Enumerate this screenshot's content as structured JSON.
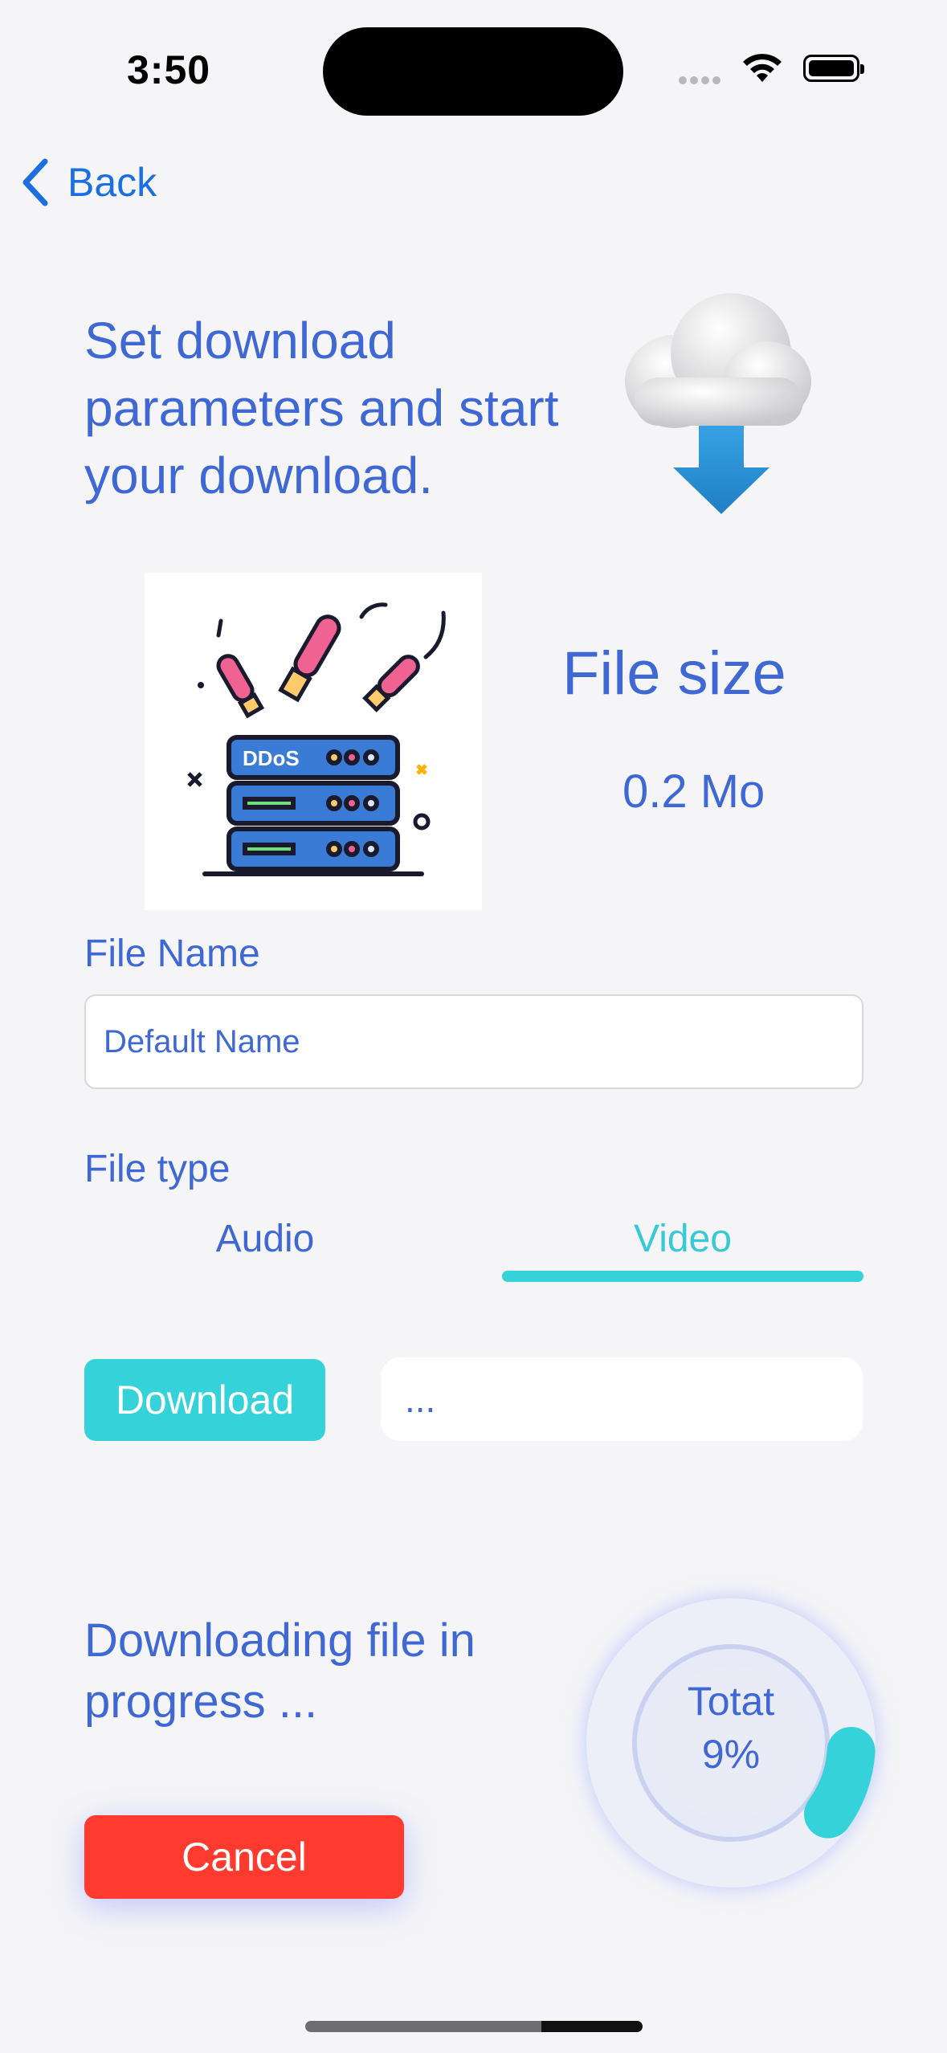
{
  "status_bar": {
    "time": "3:50"
  },
  "nav": {
    "back_label": "Back"
  },
  "header": {
    "headline": "Set download parameters and start your download."
  },
  "file": {
    "size_label": "File size",
    "size_value": "0.2 Mo",
    "name_label": "File Name",
    "name_value": "Default Name",
    "type_label": "File type",
    "type_options": [
      "Audio",
      "Video"
    ],
    "selected_type": "Video"
  },
  "actions": {
    "download_label": "Download",
    "status_text": "...",
    "cancel_label": "Cancel"
  },
  "progress": {
    "message": "Downloading file in progress ...",
    "ring_title": "Totat",
    "ring_percent_label": "9%",
    "percent": 9
  },
  "illustration": {
    "badge_text": "DDoS"
  },
  "colors": {
    "primary_text": "#3f68d4",
    "accent": "#35d3d9",
    "danger": "#ff3b30",
    "link": "#1b6fe0"
  }
}
